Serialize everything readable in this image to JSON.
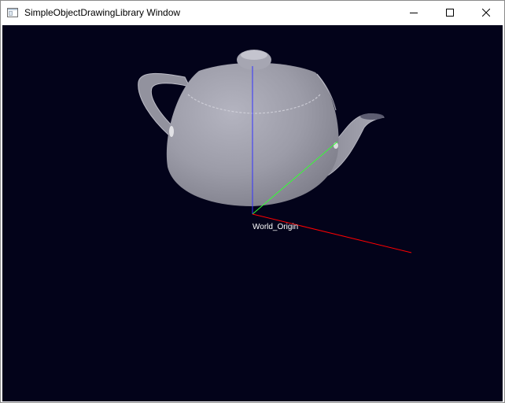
{
  "window": {
    "title": "SimpleObjectDrawingLibrary Window",
    "app_icon": "window-app-icon",
    "controls": {
      "minimize_icon": "minimize-icon",
      "maximize_icon": "maximize-icon",
      "close_icon": "close-icon"
    }
  },
  "scene": {
    "background_color": "#03031a",
    "object": "teapot",
    "object_color": "#9a9aa6",
    "axes": {
      "x_color": "#ff0000",
      "y_color": "#00ff00",
      "z_color": "#3333ff"
    },
    "origin_label": "World_Origin"
  }
}
